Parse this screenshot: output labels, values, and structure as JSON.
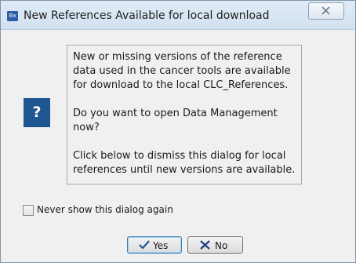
{
  "window": {
    "title": "New References Available for local download",
    "app_icon_text": "Bx",
    "close_icon": "close-icon"
  },
  "message": {
    "icon_symbol": "?",
    "icon_color": "#1f5591",
    "paragraphs": [
      "New or missing versions of the reference data used in the cancer tools are available for download to the local CLC_References.",
      "Do you want to open Data Management now?",
      "Click below to dismiss this dialog for local references until new versions are available."
    ]
  },
  "checkbox": {
    "label": "Never show this dialog again",
    "checked": false
  },
  "buttons": {
    "yes_label": "Yes",
    "yes_icon": "checkmark-icon",
    "yes_icon_color": "#1f5591",
    "no_label": "No",
    "no_icon": "x-icon",
    "no_icon_color": "#1f3f7a"
  }
}
